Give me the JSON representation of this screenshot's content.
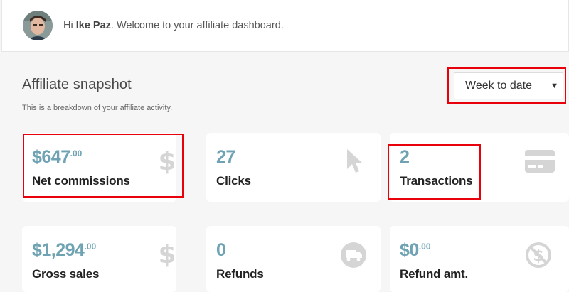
{
  "welcome": {
    "greeting_prefix": "Hi ",
    "user_name": "Ike Paz",
    "greeting_suffix": ". Welcome to your affiliate dashboard."
  },
  "snapshot": {
    "title": "Affiliate snapshot",
    "subtitle": "This is a breakdown of your affiliate activity.",
    "range_selected": "Week to date"
  },
  "cards": [
    {
      "value": "$647",
      "cents": ".00",
      "label": "Net commissions",
      "icon": "dollar-icon"
    },
    {
      "value": "27",
      "cents": "",
      "label": "Clicks",
      "icon": "cursor-icon"
    },
    {
      "value": "2",
      "cents": "",
      "label": "Transactions",
      "icon": "credit-card-icon"
    },
    {
      "value": "$1,294",
      "cents": ".00",
      "label": "Gross sales",
      "icon": "dollar-icon"
    },
    {
      "value": "0",
      "cents": "",
      "label": "Refunds",
      "icon": "return-truck-icon"
    },
    {
      "value": "$0",
      "cents": ".00",
      "label": "Refund amt.",
      "icon": "no-dollar-icon"
    }
  ],
  "colors": {
    "accent_value": "#6fa3b3",
    "highlight_red": "#e8000a",
    "icon_gray": "#d5d5d5"
  }
}
